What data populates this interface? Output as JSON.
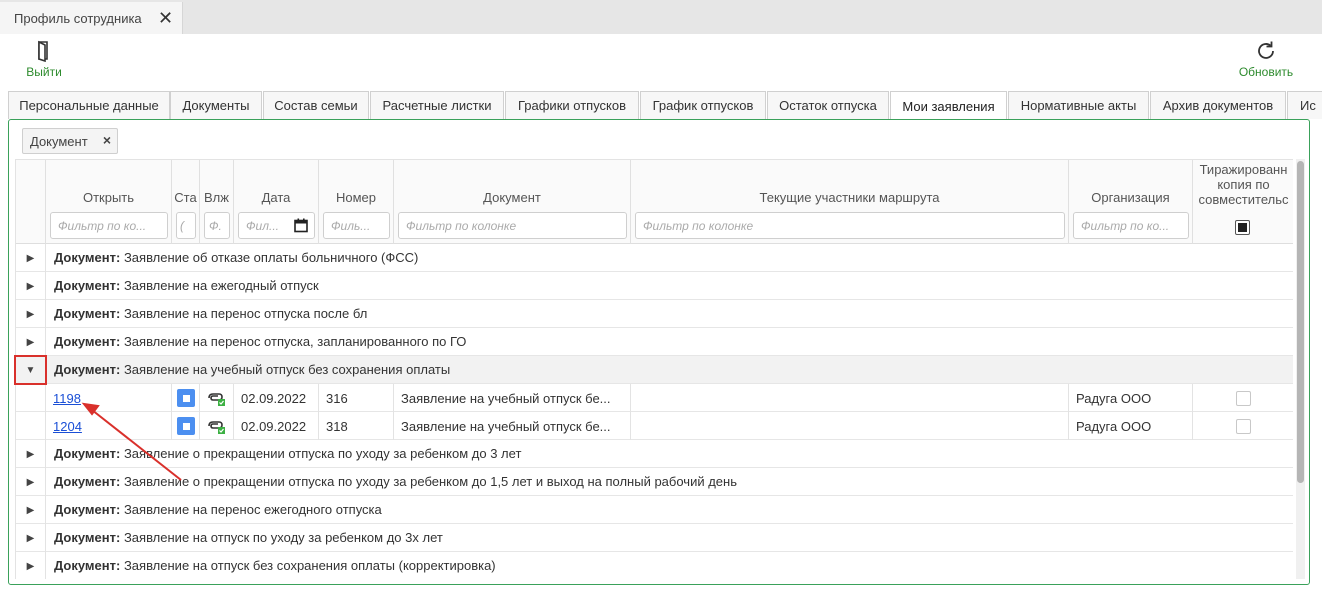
{
  "window": {
    "tab_title": "Профиль сотрудника",
    "close_symbol": "✕"
  },
  "toolbar": {
    "exit_label": "Выйти",
    "refresh_label": "Обновить"
  },
  "tabs": [
    {
      "label": "Персональные данные"
    },
    {
      "label": "Документы"
    },
    {
      "label": "Состав семьи"
    },
    {
      "label": "Расчетные листки"
    },
    {
      "label": "Графики отпусков"
    },
    {
      "label": "График отпусков"
    },
    {
      "label": "Остаток отпуска"
    },
    {
      "label": "Мои заявления",
      "active": true
    },
    {
      "label": "Нормативные акты"
    },
    {
      "label": "Архив документов"
    },
    {
      "label": "Ис"
    }
  ],
  "group_chip": {
    "label": "Документ",
    "remove": "×"
  },
  "columns": {
    "open": {
      "title": "Открыть",
      "filter": "Фильтр по ко..."
    },
    "status": {
      "title": "Ста",
      "filter": "("
    },
    "attach": {
      "title": "Влж",
      "filter": "Ф."
    },
    "date": {
      "title": "Дата",
      "filter": "Фил..."
    },
    "number": {
      "title": "Номер",
      "filter": "Филь..."
    },
    "document": {
      "title": "Документ",
      "filter": "Фильтр по колонке"
    },
    "route": {
      "title": "Текущие участники маршрута",
      "filter": "Фильтр по колонке"
    },
    "org": {
      "title": "Организация",
      "filter": "Фильтр по ко..."
    },
    "copy": {
      "title": "Тиражированн копия по совместительс"
    }
  },
  "group_prefix": "Документ:",
  "groups_before": [
    "Заявление об отказе оплаты больничного (ФСС)",
    "Заявление на ежегодный отпуск",
    "Заявление на перенос отпуска после бл",
    "Заявление на перенос отпуска, запланированного по ГО"
  ],
  "expanded_group": "Заявление на учебный отпуск без сохранения оплаты",
  "detail_rows": [
    {
      "open": "1198",
      "date": "02.09.2022",
      "number": "316",
      "document": "Заявление на учебный отпуск бе...",
      "route": "",
      "org": "Радуга ООО"
    },
    {
      "open": "1204",
      "date": "02.09.2022",
      "number": "318",
      "document": "Заявление на учебный отпуск бе...",
      "route": "",
      "org": "Радуга ООО"
    }
  ],
  "groups_after": [
    "Заявление о прекращении отпуска по уходу за ребенком до 3 лет",
    "Заявление о прекращении отпуска по уходу за ребенком до 1,5 лет и выход на полный рабочий день",
    "Заявление на перенос ежегодного отпуска",
    "Заявление на отпуск по уходу за ребенком до 3х лет",
    "Заявление на отпуск без сохранения оплаты (корректировка)"
  ],
  "colors": {
    "accent_green": "#2e8b2e",
    "panel_border": "#3aa15a",
    "annotation_red": "#d9302b",
    "link_blue": "#1a4fd6"
  }
}
